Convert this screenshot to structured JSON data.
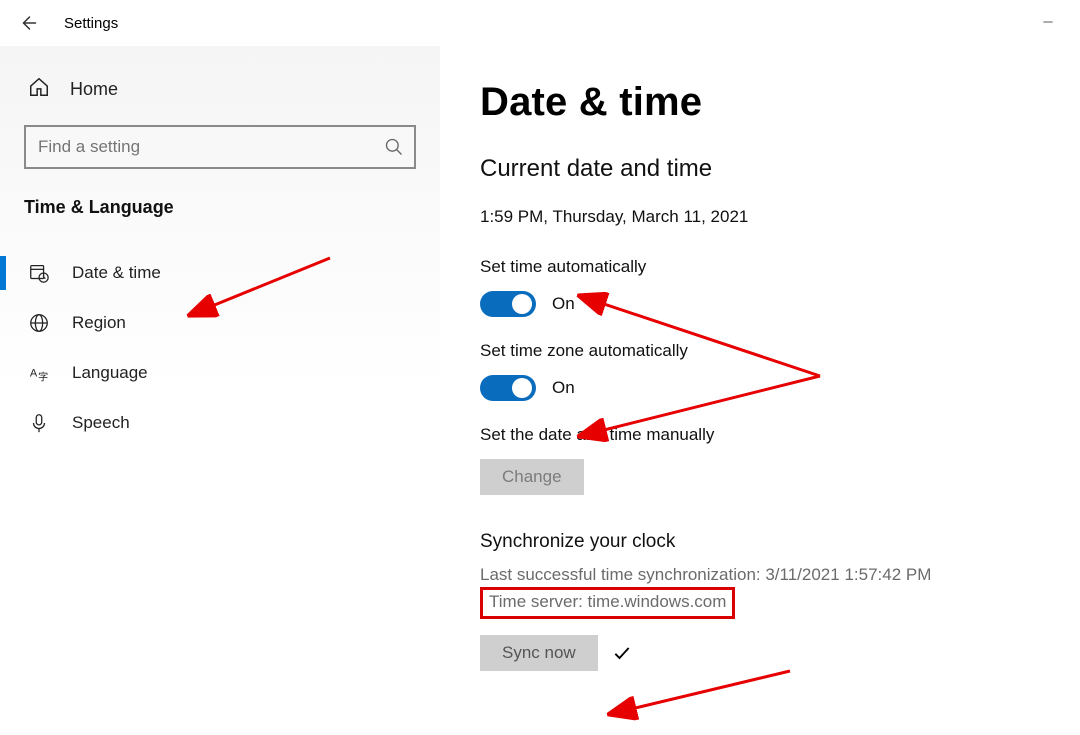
{
  "window": {
    "title": "Settings"
  },
  "sidebar": {
    "home_label": "Home",
    "search_placeholder": "Find a setting",
    "category_label": "Time & Language",
    "items": [
      {
        "label": "Date & time"
      },
      {
        "label": "Region"
      },
      {
        "label": "Language"
      },
      {
        "label": "Speech"
      }
    ]
  },
  "main": {
    "title": "Date & time",
    "subtitle": "Current date and time",
    "current_datetime": "1:59 PM, Thursday, March 11, 2021",
    "opt1_label": "Set time automatically",
    "opt1_state": "On",
    "opt2_label": "Set time zone automatically",
    "opt2_state": "On",
    "manual_label": "Set the date and time manually",
    "change_btn": "Change",
    "sync_title": "Synchronize your clock",
    "sync_last": "Last successful time synchronization: 3/11/2021 1:57:42 PM",
    "sync_server": "Time server: time.windows.com",
    "sync_btn": "Sync now"
  }
}
